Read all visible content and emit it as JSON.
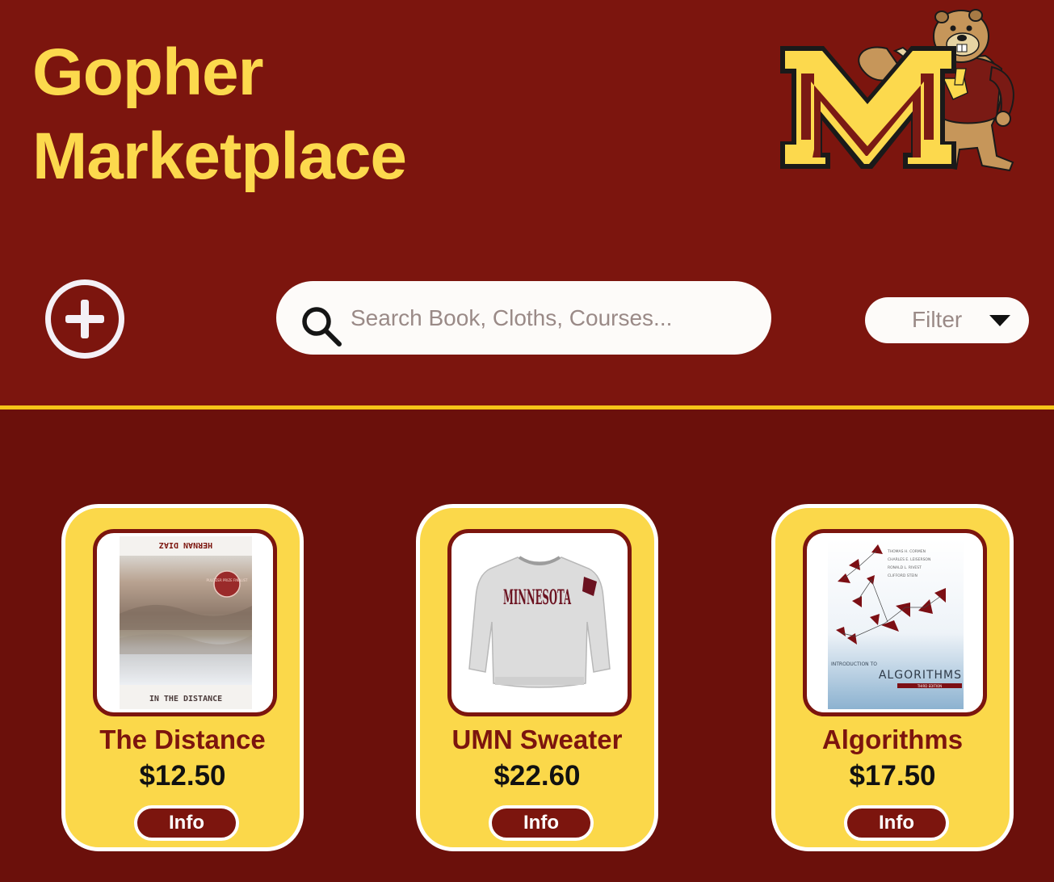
{
  "app": {
    "title_line1": "Gopher",
    "title_line2": "Marketplace"
  },
  "colors": {
    "header_bg": "#7c150e",
    "main_bg": "#6b100b",
    "gold": "#fcd94d",
    "maroon": "#7c150e",
    "divider": "#f5c518"
  },
  "toolbar": {
    "add_icon": "plus-circle-icon",
    "search_icon": "search-icon",
    "search_placeholder": "Search Book, Cloths, Courses...",
    "search_value": "",
    "filter_label": "Filter",
    "filter_icon": "caret-down-icon"
  },
  "products": [
    {
      "name": "The Distance",
      "price": "$12.50",
      "info_label": "Info",
      "cover": {
        "top_text": "HERNAN DIAZ",
        "badge_text": "PULITZER PRIZE FINALIST",
        "bottom_text": "IN THE DISTANCE"
      }
    },
    {
      "name": "UMN Sweater",
      "price": "$22.60",
      "info_label": "Info",
      "sweater_text": "MINNESOTA"
    },
    {
      "name": "Algorithms",
      "price": "$17.50",
      "info_label": "Info",
      "cover": {
        "authors": [
          "THOMAS H. CORMEN",
          "CHARLES E. LEISERSON",
          "RONALD L. RIVEST",
          "CLIFFORD STEIN"
        ],
        "subtitle": "INTRODUCTION TO",
        "title": "ALGORITHMS",
        "edition": "THIRD EDITION"
      }
    }
  ]
}
